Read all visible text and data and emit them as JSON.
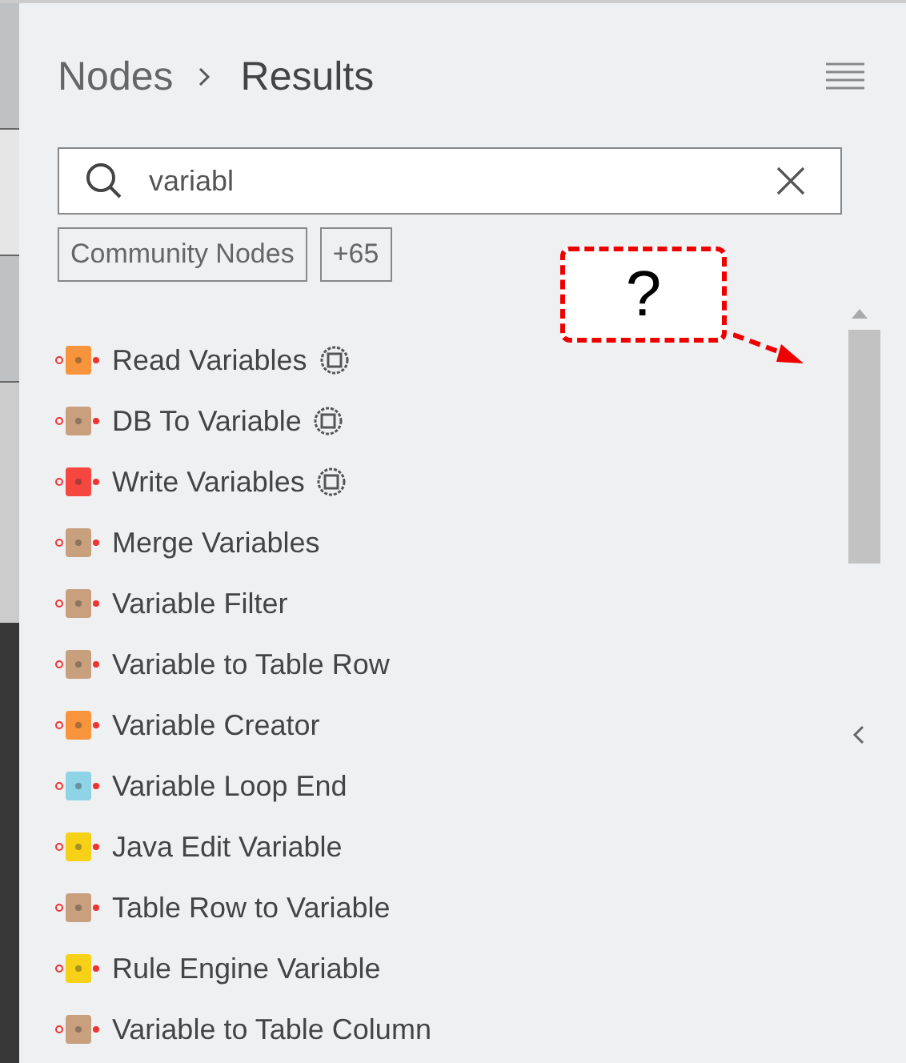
{
  "breadcrumb": {
    "parent": "Nodes",
    "current": "Results"
  },
  "search": {
    "value": "variabl"
  },
  "chips": [
    "Community Nodes",
    "+65"
  ],
  "callout": {
    "text": "?"
  },
  "nodes": [
    {
      "name": "Read Variables",
      "color": "#f7943c",
      "community": true
    },
    {
      "name": "DB To Variable",
      "color": "#c8a07e",
      "community": true
    },
    {
      "name": "Write Variables",
      "color": "#f5463f",
      "community": true
    },
    {
      "name": "Merge Variables",
      "color": "#c8a07e",
      "community": false
    },
    {
      "name": "Variable Filter",
      "color": "#c8a07e",
      "community": false
    },
    {
      "name": "Variable to Table Row",
      "color": "#c8a07e",
      "community": false
    },
    {
      "name": "Variable Creator",
      "color": "#f7943c",
      "community": false
    },
    {
      "name": "Variable Loop End",
      "color": "#8fd3e6",
      "community": false
    },
    {
      "name": "Java Edit Variable",
      "color": "#f7d117",
      "community": false
    },
    {
      "name": "Table Row to Variable",
      "color": "#c8a07e",
      "community": false
    },
    {
      "name": "Rule Engine Variable",
      "color": "#f7d117",
      "community": false
    },
    {
      "name": "Variable to Table Column",
      "color": "#c8a07e",
      "community": false
    }
  ]
}
